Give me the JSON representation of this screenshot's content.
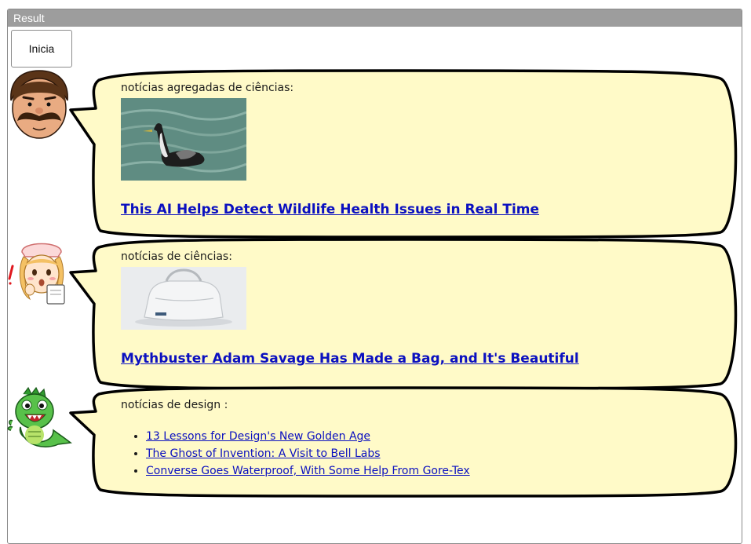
{
  "panel": {
    "title": "Result"
  },
  "toolbar": {
    "start_label": "Inicia"
  },
  "messages": [
    {
      "label": "notícias agregadas de ciências:",
      "headline": "This AI Helps Detect Wildlife Health Issues in Real Time",
      "image": "grebe-on-water"
    },
    {
      "label": "notícias de ciências:",
      "headline": "Mythbuster Adam Savage Has Made a Bag, and It's Beautiful",
      "image": "white-bag"
    },
    {
      "label": "notícias de design :",
      "links": [
        "13 Lessons for Design's New Golden Age",
        "The Ghost of Invention: A Visit to Bell Labs",
        "Converse Goes Waterproof, With Some Help From Gore-Tex"
      ]
    }
  ],
  "avatars": [
    "mustache-man-icon",
    "nurse-icon",
    "green-monster-icon"
  ],
  "colors": {
    "bubble_fill": "#fffac8",
    "link": "#0b10c0",
    "header": "#9d9d9d"
  }
}
